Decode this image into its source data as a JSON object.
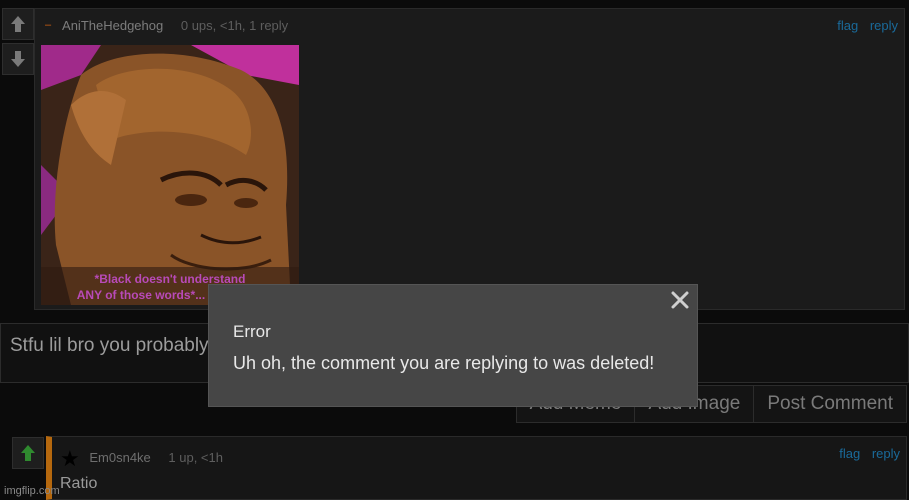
{
  "comment1": {
    "username": "AniTheHedgehog",
    "meta": "0 ups, <1h, 1 reply",
    "flag_label": "flag",
    "reply_label": "reply",
    "image_caption_line1": "*Black doesn't understand",
    "image_caption_line2": "ANY of those words*..."
  },
  "reply_box": {
    "text": "Stfu lil bro you probably"
  },
  "buttons": {
    "add_meme": "Add Meme",
    "add_image": "Add Image",
    "post_comment": "Post Comment"
  },
  "modal": {
    "title": "Error",
    "message": "Uh oh, the comment you are replying to was deleted!"
  },
  "comment2": {
    "username": "Em0sn4ke",
    "meta": "1 up, <1h",
    "flag_label": "flag",
    "reply_label": "reply",
    "text": "Ratio"
  },
  "watermark": "imgflip.com",
  "colors": {
    "page_bg": "#0b0b0b",
    "comment_bg": "#1b1b1b",
    "modal_bg": "#464646",
    "link": "#1a6a9a",
    "upvote_active": "#2f8a2f",
    "accent_bar": "#b5680e"
  },
  "icons": {
    "upvote": "arrow-up-icon",
    "downvote": "arrow-down-icon",
    "close": "close-icon",
    "star": "star-icon"
  }
}
